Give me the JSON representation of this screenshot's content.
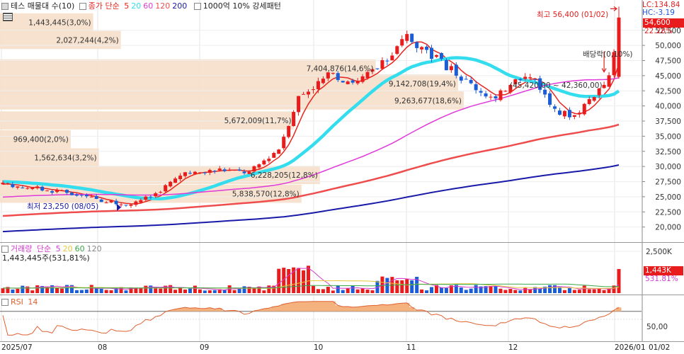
{
  "legend": {
    "title": "테스 매물대 수(10)",
    "ma_label": "종가 단순",
    "ma_periods": [
      "5",
      "20",
      "60",
      "120",
      "200"
    ],
    "ma_colors": [
      "#e8251e",
      "#33ddee",
      "#e03ad8",
      "#ef4d4d",
      "#1a1aa8"
    ],
    "note": "1000억 10% 강세패턴"
  },
  "price_scale": {
    "lc": "LC:134.84",
    "hc": "HC:-3.19",
    "current_price": "54,600",
    "current_change": "22.28%",
    "ticks": [
      "52,500",
      "50,000",
      "47,500",
      "45,000",
      "42,500",
      "40,000",
      "37,500",
      "35,000",
      "32,500",
      "30,000",
      "27,500",
      "25,000",
      "22,500",
      "20,000"
    ]
  },
  "annotations": {
    "high": "최고 56,400 (01/02)",
    "low": "최저 23,250 (08/05)",
    "dividend": "배당락(0,10%)",
    "range": "(45,420,00 ~ 42,360,00)"
  },
  "volume_profile": [
    {
      "label": "1,443,445(3,0%)"
    },
    {
      "label": "2,027,244(4,2%)"
    },
    {
      "label": "7,404,876(14,6%)"
    },
    {
      "label": "9,142,708(19,4%)"
    },
    {
      "label": "9,263,677(18,6%)"
    },
    {
      "label": "5,672,009(11,7%)"
    },
    {
      "label": "969,400(2,0%)"
    },
    {
      "label": "1,562,634(3,2%)"
    },
    {
      "label": "6,228,205(12,8%)"
    },
    {
      "label": "5,838,570(12,8%)"
    }
  ],
  "volume_panel": {
    "title": "거래량",
    "ma_label": "단순",
    "ma_periods": [
      "5",
      "20",
      "60",
      "120"
    ],
    "ma_colors": [
      "#d43ad0",
      "#e6c83a",
      "#3aa84a",
      "#888888"
    ],
    "current": "1,443,445주(531,81%)",
    "scale_top": "2,500K",
    "current_value": "1,443K",
    "current_pct": "531.81%"
  },
  "rsi_panel": {
    "title": "RSI",
    "period": "14",
    "level": "50,00"
  },
  "x_axis": {
    "labels": [
      "2025/07",
      "08",
      "09",
      "10",
      "11",
      "12",
      "2026/01",
      "01/02"
    ]
  },
  "chart_data": {
    "type": "candlestick",
    "ylim": [
      17500,
      57500
    ],
    "dates": [
      "2025/07",
      "08",
      "09",
      "10",
      "11",
      "12",
      "2026/01"
    ],
    "monthly_close": [
      27000,
      24000,
      29000,
      46000,
      44000,
      38500,
      54600
    ],
    "volume_profile_bins": [
      {
        "price": 53800,
        "volume": 1443445,
        "pct": 3.0
      },
      {
        "price": 50900,
        "volume": 2027244,
        "pct": 4.2
      },
      {
        "price": 46200,
        "volume": 7404876,
        "pct": 14.6
      },
      {
        "price": 43700,
        "volume": 9142708,
        "pct": 19.4
      },
      {
        "price": 40900,
        "volume": 9263677,
        "pct": 18.6
      },
      {
        "price": 37600,
        "volume": 5672009,
        "pct": 11.7
      },
      {
        "price": 34500,
        "volume": 969400,
        "pct": 2.0
      },
      {
        "price": 31500,
        "volume": 1562634,
        "pct": 3.2
      },
      {
        "price": 28600,
        "volume": 6228205,
        "pct": 12.8
      },
      {
        "price": 25500,
        "volume": 5838570,
        "pct": 12.8
      }
    ],
    "high": {
      "date": "01/02",
      "value": 56400
    },
    "low": {
      "date": "08/05",
      "value": 23250
    },
    "volume_last": 1443445,
    "rsi_level": 50
  }
}
